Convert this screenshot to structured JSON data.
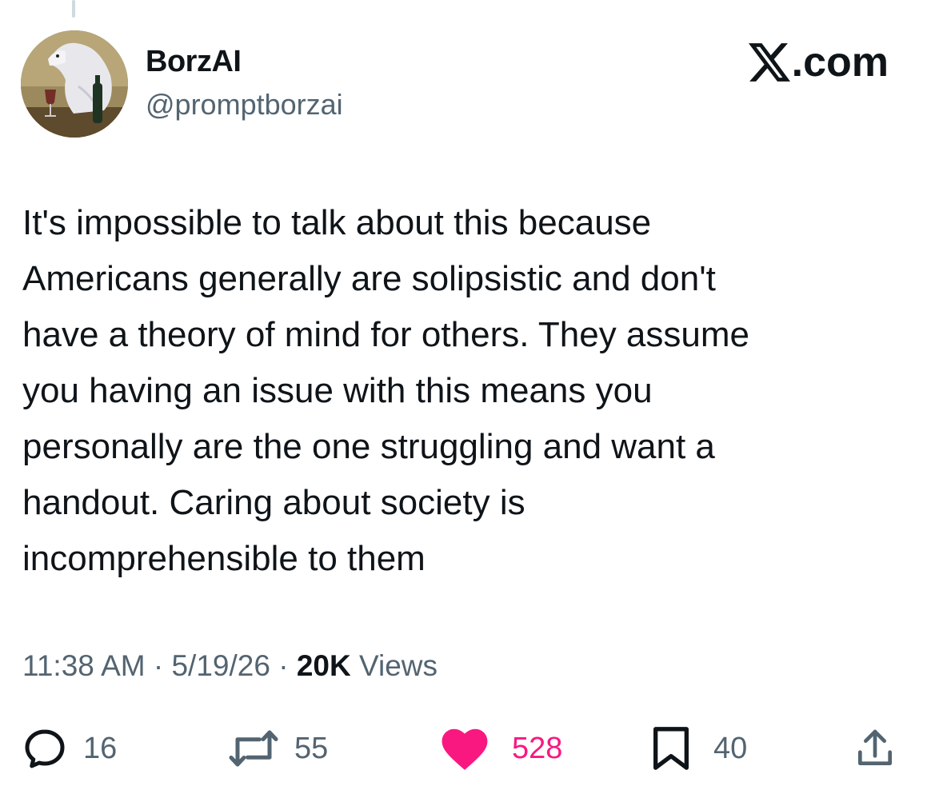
{
  "author": {
    "display_name": "BorzAI",
    "handle": "@promptborzai"
  },
  "brand": {
    "text": ".com",
    "icon": "x-logo-icon"
  },
  "tweet": {
    "lines": [
      "It's impossible to talk about this because",
      "Americans generally are solipsistic and don't",
      "have a theory of mind for others. They assume",
      "you having an issue with this means you",
      "personally are the one struggling and want a",
      "handout. Caring about society is",
      "incomprehensible to them"
    ]
  },
  "meta": {
    "time": "11:38 AM",
    "separator": "·",
    "date": "5/19/26",
    "views_count": "20K",
    "views_label": "Views"
  },
  "actions": {
    "replies": "16",
    "reposts": "55",
    "likes": "528",
    "bookmarks": "40"
  },
  "colors": {
    "text": "#0f1419",
    "secondary": "#536471",
    "like": "#f91880"
  }
}
